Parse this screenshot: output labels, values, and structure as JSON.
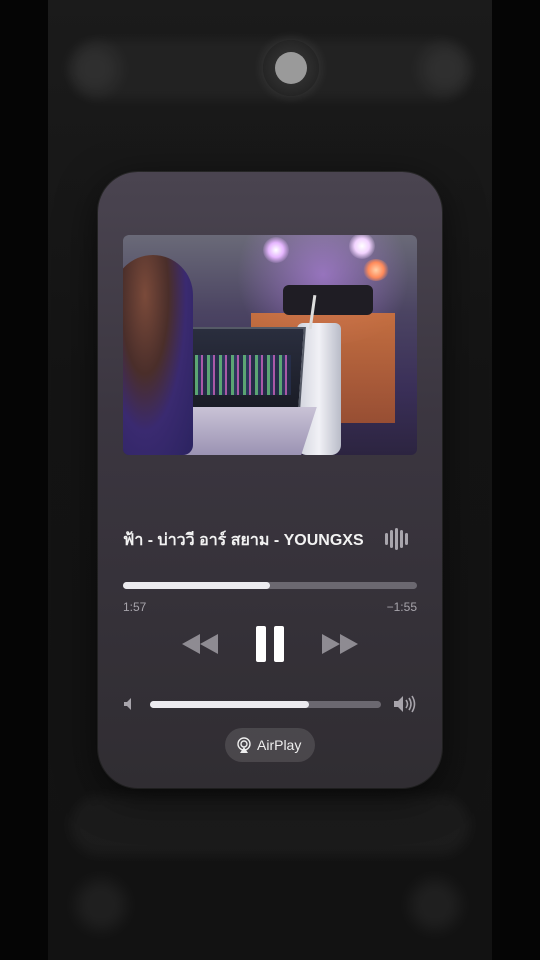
{
  "now_playing": {
    "title": "ฟ้า - บ่าววี อาร์ สยาม - YOUNGXS",
    "elapsed": "1:57",
    "remaining": "−1:55",
    "progress_fraction": 0.5,
    "volume_fraction": 0.69
  },
  "airplay": {
    "label": "AirPlay"
  },
  "icons": {
    "waveform": "waveform-icon",
    "rewind": "rewind-icon",
    "pause": "pause-icon",
    "forward": "fast-forward-icon",
    "volume_low": "speaker-low-icon",
    "volume_high": "speaker-high-icon",
    "airplay": "airplay-icon"
  },
  "colors": {
    "card_top": "#4a4450",
    "card_bottom": "#302d32",
    "slider_fill": "#ecebef",
    "slider_track": "#6b6870"
  }
}
